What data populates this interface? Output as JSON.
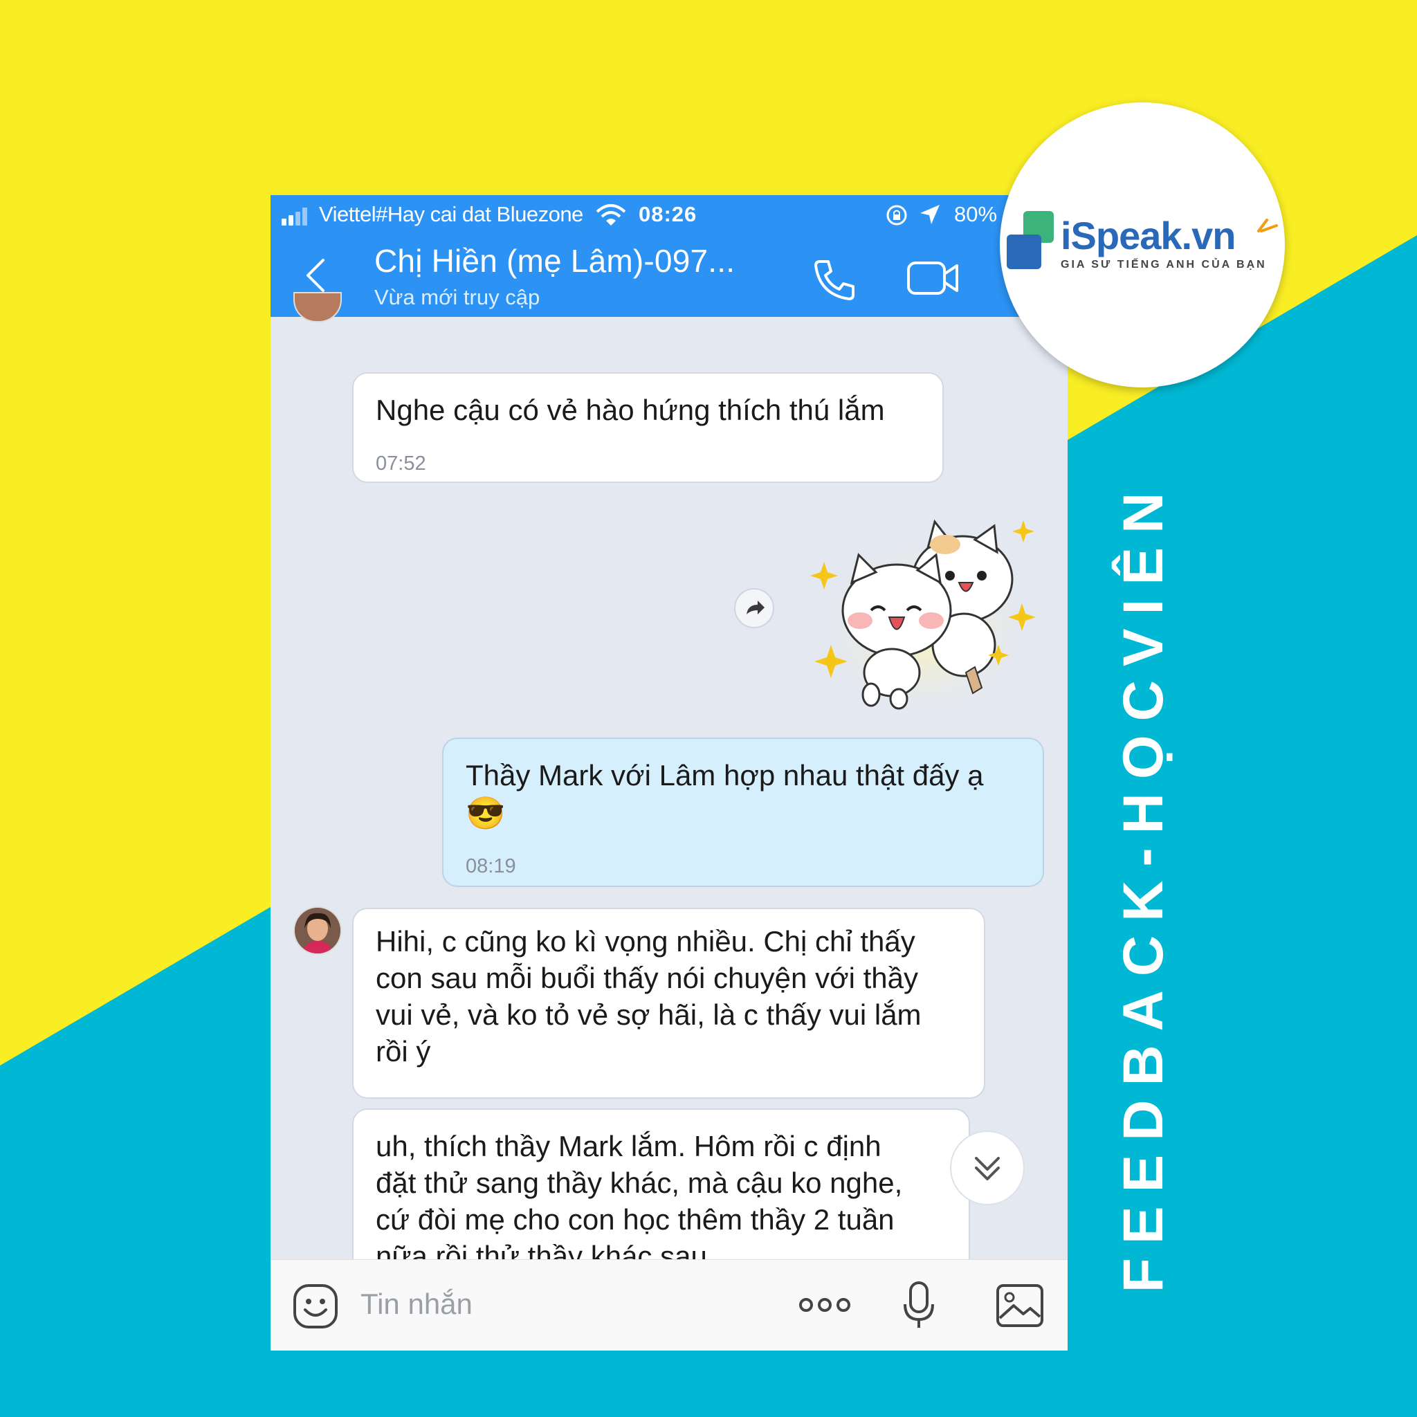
{
  "colors": {
    "background_yellow": "#f9ed24",
    "background_cyan": "#00b8d4",
    "header_blue": "#2c93f4",
    "chat_background": "#e4e8f1",
    "outgoing_bubble": "#d6effc",
    "logo_blue": "#2a69b7",
    "logo_green": "#3bb37a",
    "logo_orange": "#f39c12"
  },
  "status_bar": {
    "carrier": "Viettel#Hay cai dat Bluezone",
    "time": "08:26",
    "battery": "80%"
  },
  "header": {
    "title": "Chị Hiền (mẹ Lâm)-097...",
    "subtitle": "Vừa mới truy cập"
  },
  "messages": [
    {
      "text": "Nghe cậu có vẻ hào hứng thích thú lắm",
      "time": "07:52"
    },
    {
      "text": "Thầy Mark với Lâm hợp nhau thật đấy ạ",
      "emoji": "😎",
      "time": "08:19"
    },
    {
      "lines": [
        "Hihi, c cũng ko kì vọng nhiều. Chị chỉ thấy",
        "con sau mỗi buổi thấy nói chuyện với thầy",
        "vui vẻ, và ko tỏ vẻ sợ hãi, là c thấy vui lắm",
        "rồi ý"
      ]
    },
    {
      "lines": [
        "uh, thích thầy Mark lắm. Hôm rồi c định",
        "đặt thử sang thầy khác, mà cậu ko nghe,",
        "cứ đòi mẹ cho con học thêm thầy 2 tuần",
        "nữa rồi thử thầy khác sau"
      ]
    }
  ],
  "input": {
    "placeholder": "Tin nhắn"
  },
  "logo": {
    "brand": "iSpeak.vn",
    "tagline": "GIA SƯ TIẾNG ANH CỦA BẠN"
  },
  "side_label": "FEEDBACK-HỌCVIÊN",
  "icons": [
    "back-icon",
    "phone-call-icon",
    "video-call-icon",
    "share-forward-icon",
    "scroll-down-icon",
    "emoji-icon",
    "more-icon",
    "microphone-icon",
    "gallery-icon"
  ]
}
